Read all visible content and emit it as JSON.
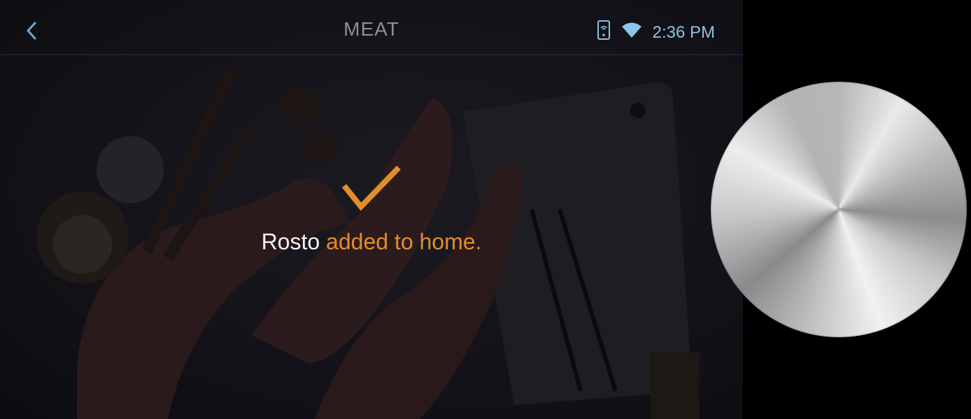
{
  "header": {
    "title": "MEAT",
    "time": "2:36 PM",
    "icons": [
      "back-chevron-icon",
      "phone-connected-icon",
      "wifi-icon"
    ]
  },
  "notification": {
    "item_name": "Rosto",
    "message": " added to home.",
    "icon": "checkmark-icon"
  },
  "colors": {
    "accent": "#e28d2c",
    "status_blue": "#8cc3e6",
    "title_gray": "#8d9097"
  },
  "control": {
    "icon": "rotary-dial"
  }
}
